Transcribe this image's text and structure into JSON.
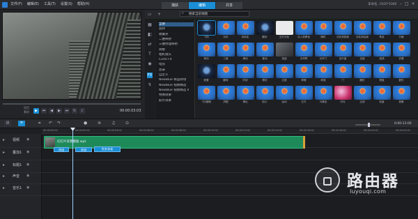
{
  "menu": [
    "文件(F)",
    "编辑(E)",
    "工具(T)",
    "设置(S)",
    "帮助(H)"
  ],
  "mode_tabs": [
    {
      "label": "捕获"
    },
    {
      "label": "编辑"
    },
    {
      "label": "共享"
    }
  ],
  "title_right": "未命名, 1920*1080",
  "player": {
    "mode_label": "项目",
    "clip_label": "素材",
    "timecode": "00:00:03:03"
  },
  "library": {
    "search_placeholder": "搜索当前视图",
    "folders": [
      "全部",
      "旋转",
      "收藏夹",
      "二维映射",
      "三维纹理映射",
      "调整",
      "相机镜头",
      "Corel FX",
      "暗房",
      "遮罩",
      "自定义",
      "NewBlue 样品转场",
      "NewBlue 视频精选",
      "NewBlue 视频精选 II",
      "特殊效果",
      "胶片效果"
    ],
    "thumbs": [
      {
        "label": "飞向",
        "style": "dark"
      },
      {
        "label": "淡化",
        "style": "normal"
      },
      {
        "label": "向前走",
        "style": "normal"
      },
      {
        "label": "翻页",
        "style": "dark"
      },
      {
        "label": "交叉淡化",
        "style": "white"
      },
      {
        "label": "淡入到黑色",
        "style": "normal"
      },
      {
        "label": "随机",
        "style": "normal"
      },
      {
        "label": "淡化到前面",
        "style": "normal"
      },
      {
        "label": "淡化到后面",
        "style": "normal"
      },
      {
        "label": "条纹",
        "style": "normal"
      },
      {
        "label": "方格",
        "style": "normal"
      },
      {
        "label": "单向",
        "style": "normal"
      },
      {
        "label": "三维",
        "style": "normal"
      },
      {
        "label": "滑动",
        "style": "normal"
      },
      {
        "label": "推动",
        "style": "normal"
      },
      {
        "label": "扭曲",
        "style": "gray"
      },
      {
        "label": "手风琴",
        "style": "normal"
      },
      {
        "label": "对开门",
        "style": "normal"
      },
      {
        "label": "百叶窗",
        "style": "normal"
      },
      {
        "label": "拉链",
        "style": "normal"
      },
      {
        "label": "漩涡",
        "style": "normal"
      },
      {
        "label": "折叠",
        "style": "normal"
      },
      {
        "label": "遮罩",
        "style": "dark"
      },
      {
        "label": "翻转",
        "style": "normal"
      },
      {
        "label": "时钟",
        "style": "normal"
      },
      {
        "label": "擦拭",
        "style": "normal"
      },
      {
        "label": "交错",
        "style": "normal"
      },
      {
        "label": "伸展",
        "style": "normal"
      },
      {
        "label": "剥落",
        "style": "normal"
      },
      {
        "label": "门",
        "style": "normal"
      },
      {
        "label": "圆形",
        "style": "normal"
      },
      {
        "label": "棋盘",
        "style": "normal"
      },
      {
        "label": "菱形",
        "style": "normal"
      },
      {
        "label": "飞行翻转",
        "style": "normal"
      },
      {
        "label": "拼图",
        "style": "normal"
      },
      {
        "label": "滑出",
        "style": "normal"
      },
      {
        "label": "胶片",
        "style": "normal"
      },
      {
        "label": "运动",
        "style": "normal"
      },
      {
        "label": "交叉",
        "style": "normal"
      },
      {
        "label": "马赛克",
        "style": "normal"
      },
      {
        "label": "闪光",
        "style": "pink"
      },
      {
        "label": "过滤",
        "style": "normal"
      },
      {
        "label": "轮盘",
        "style": "normal"
      },
      {
        "label": "遮蔽",
        "style": "normal"
      }
    ]
  },
  "timeline": {
    "timecode": "0:00:13:00",
    "ruler": [
      "00:00:00:00",
      "00:00:02:00",
      "00:00:04:00",
      "00:00:06:00",
      "00:00:08:00",
      "00:00:10:00",
      "00:00:12:00",
      "00:00:14:00",
      "00:00:16:00",
      "00:00:18:00",
      "00:00:20:00",
      "00:00:22:00"
    ],
    "tracks": [
      "视频",
      "叠加1",
      "标题1",
      "声音",
      "音乐1"
    ],
    "clip_name": "幻灯片背景模板.wpt",
    "transitions": [
      "淡出",
      "淡出",
      "交叉淡化"
    ]
  },
  "watermark": {
    "title": "路由器",
    "sub": "luyouqi.com"
  }
}
